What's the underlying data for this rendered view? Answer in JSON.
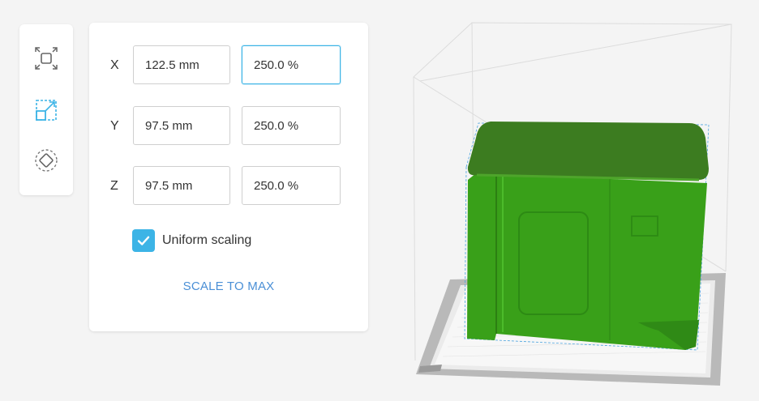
{
  "tools": [
    {
      "name": "fit-view-icon"
    },
    {
      "name": "scale-tool-icon",
      "active": true
    },
    {
      "name": "rotate-tool-icon"
    }
  ],
  "scale_panel": {
    "rows": [
      {
        "axis": "X",
        "size": "122.5 mm",
        "percent": "250.0 %"
      },
      {
        "axis": "Y",
        "size": "97.5 mm",
        "percent": "250.0 %"
      },
      {
        "axis": "Z",
        "size": "97.5 mm",
        "percent": "250.0 %"
      }
    ],
    "uniform_scaling_label": "Uniform scaling",
    "uniform_scaling_checked": true,
    "scale_to_max_label": "SCALE TO MAX"
  },
  "colors": {
    "accent": "#3cb4e6",
    "link": "#4a8fd6",
    "model_green": "#3a9a1a",
    "model_top": "#3a7f1f"
  }
}
